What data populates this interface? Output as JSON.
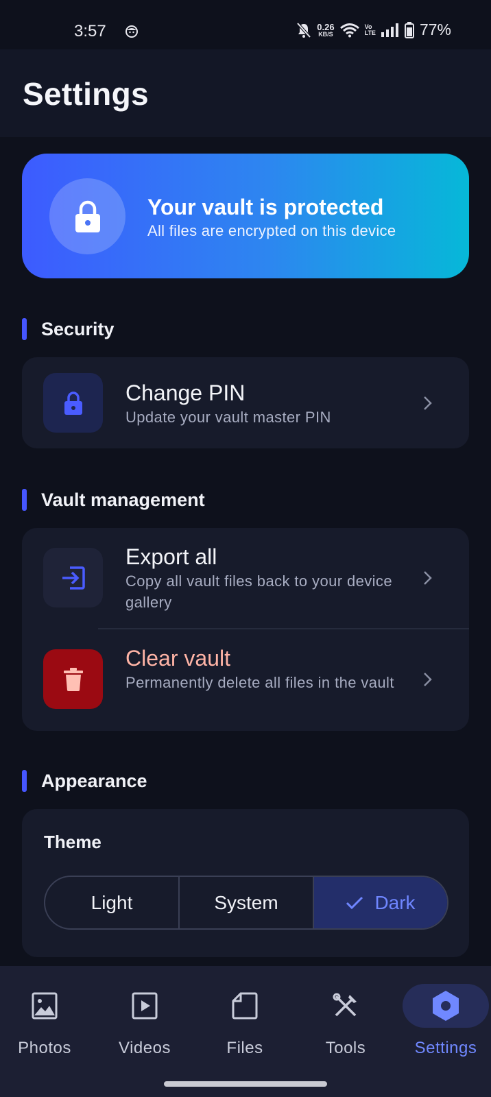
{
  "status_bar": {
    "time": "3:57",
    "net_speed": "0.26",
    "net_unit": "KB/S",
    "volte_top": "Vo",
    "volte_bottom": "LTE",
    "battery": "77%"
  },
  "header": {
    "title": "Settings"
  },
  "hero": {
    "title": "Your vault is protected",
    "subtitle": "All files are encrypted on this device"
  },
  "sections": {
    "security": {
      "label": "Security",
      "change_pin": {
        "title": "Change PIN",
        "subtitle": "Update your vault master PIN"
      }
    },
    "vault": {
      "label": "Vault management",
      "export_all": {
        "title": "Export all",
        "subtitle": "Copy all vault files back to your device gallery"
      },
      "clear_vault": {
        "title": "Clear vault",
        "subtitle": "Permanently delete all files in the vault"
      }
    },
    "appearance": {
      "label": "Appearance",
      "theme_label": "Theme",
      "options": [
        "Light",
        "System",
        "Dark"
      ],
      "selected": "Dark"
    }
  },
  "bottom_nav": {
    "items": [
      {
        "label": "Photos",
        "icon": "image-icon"
      },
      {
        "label": "Videos",
        "icon": "video-icon"
      },
      {
        "label": "Files",
        "icon": "file-icon"
      },
      {
        "label": "Tools",
        "icon": "tools-icon"
      },
      {
        "label": "Settings",
        "icon": "settings-icon"
      }
    ],
    "active": "Settings"
  },
  "colors": {
    "background": "#0e111c",
    "card": "#171b2b",
    "accent": "#4656ff",
    "danger_text": "#ffb4a6",
    "danger_tile": "#9b0a12",
    "hero_gradient_start": "#3d5bff",
    "hero_gradient_end": "#06b8d8"
  }
}
